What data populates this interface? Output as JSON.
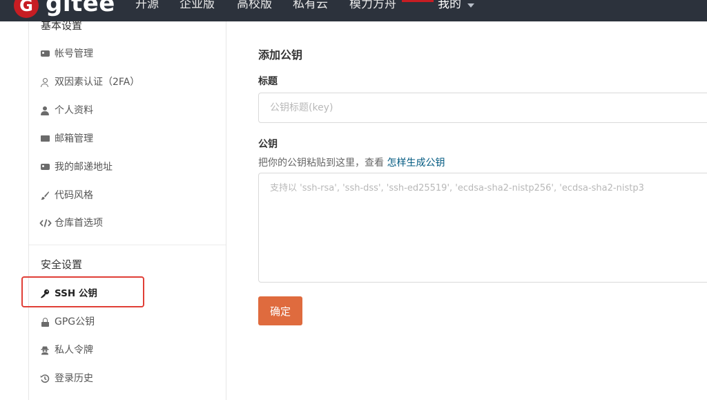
{
  "header": {
    "logo_letter": "G",
    "logo_text": "gitee",
    "nav": [
      "开源",
      "企业版",
      "高校版",
      "私有云",
      "模力方舟"
    ],
    "mine_label": "我的",
    "brand_color": "#c71d23"
  },
  "sidebar": {
    "basic_title": "基本设置",
    "basic_items": [
      {
        "label": "帐号管理",
        "icon": "id-card-icon"
      },
      {
        "label": "双因素认证（2FA）",
        "icon": "user-shield-icon"
      },
      {
        "label": "个人资料",
        "icon": "user-icon"
      },
      {
        "label": "邮箱管理",
        "icon": "envelope-icon"
      },
      {
        "label": "我的邮递地址",
        "icon": "address-card-icon"
      },
      {
        "label": "代码风格",
        "icon": "paint-brush-icon"
      },
      {
        "label": "仓库首选项",
        "icon": "code-icon"
      }
    ],
    "security_title": "安全设置",
    "security_items": [
      {
        "label": "SSH 公钥",
        "icon": "key-icon",
        "active": true
      },
      {
        "label": "GPG公钥",
        "icon": "lock-icon"
      },
      {
        "label": "私人令牌",
        "icon": "user-secret-icon"
      },
      {
        "label": "登录历史",
        "icon": "history-icon"
      }
    ]
  },
  "main": {
    "title": "添加公钥",
    "title_label": "标题",
    "title_placeholder": "公钥标题(key)",
    "key_label": "公钥",
    "key_hint_text": "把你的公钥粘贴到这里，查看 ",
    "key_hint_link": "怎样生成公钥",
    "key_placeholder": "支持以 'ssh-rsa', 'ssh-dss', 'ssh-ed25519', 'ecdsa-sha2-nistp256', 'ecdsa-sha2-nistp3",
    "submit_label": "确定",
    "submit_color": "#df6b3e",
    "link_color": "#005980"
  }
}
